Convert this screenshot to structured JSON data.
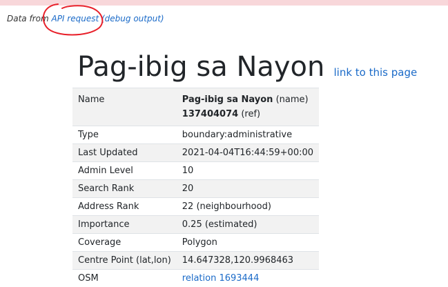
{
  "debug": {
    "prefix": "Data from",
    "api_link": "API request",
    "debug_link": "(debug output)"
  },
  "header": {
    "title": "Pag-ibig sa Nayon",
    "link": "link to this page"
  },
  "details": {
    "name": {
      "label": "Name",
      "value": "Pag-ibig sa Nayon",
      "value_suffix": "(name)",
      "ref": "137404074",
      "ref_suffix": "(ref)"
    },
    "rows": [
      {
        "label": "Type",
        "value": "boundary:administrative"
      },
      {
        "label": "Last Updated",
        "value": "2021-04-04T16:44:59+00:00"
      },
      {
        "label": "Admin Level",
        "value": "10"
      },
      {
        "label": "Search Rank",
        "value": "20"
      },
      {
        "label": "Address Rank",
        "value": "22 (neighbourhood)"
      },
      {
        "label": "Importance",
        "value": "0.25 (estimated)"
      },
      {
        "label": "Coverage",
        "value": "Polygon"
      },
      {
        "label": "Centre Point (lat,lon)",
        "value": "14.647328,120.9968463"
      }
    ],
    "osm": {
      "label": "OSM",
      "value": "relation 1693444"
    }
  },
  "colors": {
    "link": "#1a6ac8",
    "annotation": "#e8202a",
    "top_bar": "#f8d7da"
  }
}
